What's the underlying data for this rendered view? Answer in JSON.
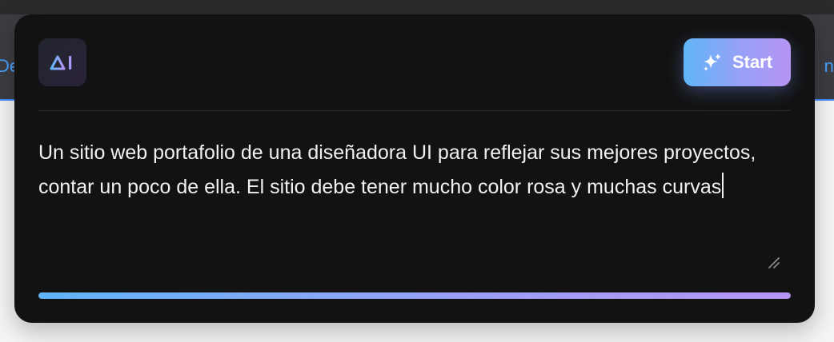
{
  "background": {
    "nav_left_fragment": "De",
    "nav_right_fragment": "nt"
  },
  "modal": {
    "logo_icon": "ai-logo-icon",
    "start_button": {
      "label": "Start",
      "icon": "sparkle-icon"
    },
    "prompt": {
      "value": "Un sitio web portafolio de una diseñadora UI para reflejar sus mejores proyectos, contar un poco de ella. El sitio debe tener mucho color rosa y muchas curvas"
    },
    "progress": 1.0
  },
  "colors": {
    "card_bg": "#121212",
    "gradient_start": "#5fb5f8",
    "gradient_end": "#b595f3",
    "nav_link": "#4aa3ff"
  }
}
